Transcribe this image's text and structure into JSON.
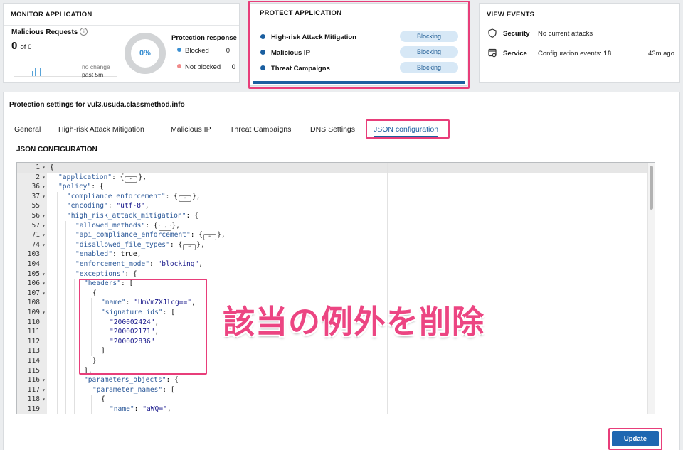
{
  "monitor": {
    "title": "MONITOR APPLICATION",
    "malicious_label": "Malicious Requests",
    "info_icon": "ⓘ",
    "value": "0",
    "of_text": "of 0",
    "no_change": "no change",
    "past": "past 5m",
    "percent": "0%",
    "protection_title": "Protection response",
    "blocked_label": "Blocked",
    "blocked_count": "0",
    "not_blocked_label": "Not blocked",
    "not_blocked_count": "0",
    "colors": {
      "blocked": "#3b8fd1",
      "not_blocked": "#f08a8a"
    }
  },
  "protect": {
    "title": "PROTECT APPLICATION",
    "rows": [
      {
        "label": "High-risk Attack Mitigation",
        "status": "Blocking"
      },
      {
        "label": "Malicious IP",
        "status": "Blocking"
      },
      {
        "label": "Threat Campaigns",
        "status": "Blocking"
      }
    ]
  },
  "events": {
    "title": "VIEW EVENTS",
    "security_label": "Security",
    "security_value": "No current attacks",
    "service_label": "Service",
    "service_value": "Configuration events:",
    "service_count": "18",
    "service_time": "43m ago",
    "icons": {
      "security": "shield-icon",
      "service": "config-icon"
    }
  },
  "main": {
    "title": "Protection settings for vul3.usuda.classmethod.info",
    "tabs": [
      "General",
      "High-risk Attack Mitigation",
      "Malicious IP",
      "Threat Campaigns",
      "DNS Settings",
      "JSON configuration"
    ],
    "active_tab": "JSON configuration",
    "section_title": "JSON CONFIGURATION",
    "update_label": "Update"
  },
  "code_lines": [
    {
      "n": "1",
      "fold": true,
      "indent": 0,
      "text": "{"
    },
    {
      "n": "2",
      "fold": true,
      "indent": 1,
      "key": "\"application\"",
      "rest": ": {",
      "collapsed": true,
      "tail": "},"
    },
    {
      "n": "36",
      "fold": true,
      "indent": 1,
      "key": "\"policy\"",
      "rest": ": {"
    },
    {
      "n": "37",
      "fold": true,
      "indent": 2,
      "key": "\"compliance_enforcement\"",
      "rest": ": {",
      "collapsed": true,
      "tail": "},"
    },
    {
      "n": "55",
      "fold": false,
      "indent": 2,
      "key": "\"encoding\"",
      "rest": ": ",
      "str": "\"utf-8\"",
      "tail": ","
    },
    {
      "n": "56",
      "fold": true,
      "indent": 2,
      "key": "\"high_risk_attack_mitigation\"",
      "rest": ": {"
    },
    {
      "n": "57",
      "fold": true,
      "indent": 3,
      "key": "\"allowed_methods\"",
      "rest": ": {",
      "collapsed": true,
      "tail": "},"
    },
    {
      "n": "71",
      "fold": true,
      "indent": 3,
      "key": "\"api_compliance_enforcement\"",
      "rest": ": {",
      "collapsed": true,
      "tail": "},"
    },
    {
      "n": "74",
      "fold": true,
      "indent": 3,
      "key": "\"disallowed_file_types\"",
      "rest": ": {",
      "collapsed": true,
      "tail": "},"
    },
    {
      "n": "103",
      "fold": false,
      "indent": 3,
      "key": "\"enabled\"",
      "rest": ": true,"
    },
    {
      "n": "104",
      "fold": false,
      "indent": 3,
      "key": "\"enforcement_mode\"",
      "rest": ": ",
      "str": "\"blocking\"",
      "tail": ","
    },
    {
      "n": "105",
      "fold": true,
      "indent": 3,
      "key": "\"exceptions\"",
      "rest": ": {"
    },
    {
      "n": "106",
      "fold": true,
      "indent": 4,
      "key": "\"headers\"",
      "rest": ": ["
    },
    {
      "n": "107",
      "fold": true,
      "indent": 5,
      "text": "{"
    },
    {
      "n": "108",
      "fold": false,
      "indent": 6,
      "key": "\"name\"",
      "rest": ": ",
      "str": "\"UmVmZXJlcg==\"",
      "tail": ","
    },
    {
      "n": "109",
      "fold": true,
      "indent": 6,
      "key": "\"signature_ids\"",
      "rest": ": ["
    },
    {
      "n": "110",
      "fold": false,
      "indent": 7,
      "str": "\"200002424\"",
      "tail": ","
    },
    {
      "n": "111",
      "fold": false,
      "indent": 7,
      "str": "\"200002171\"",
      "tail": ","
    },
    {
      "n": "112",
      "fold": false,
      "indent": 7,
      "str": "\"200002836\""
    },
    {
      "n": "113",
      "fold": false,
      "indent": 6,
      "text": "]"
    },
    {
      "n": "114",
      "fold": false,
      "indent": 5,
      "text": "}"
    },
    {
      "n": "115",
      "fold": false,
      "indent": 4,
      "text": "],"
    },
    {
      "n": "116",
      "fold": true,
      "indent": 4,
      "key": "\"parameters_objects\"",
      "rest": ": {"
    },
    {
      "n": "117",
      "fold": true,
      "indent": 5,
      "key": "\"parameter_names\"",
      "rest": ": ["
    },
    {
      "n": "118",
      "fold": true,
      "indent": 6,
      "text": "{"
    },
    {
      "n": "119",
      "fold": false,
      "indent": 7,
      "key": "\"name\"",
      "rest": ": ",
      "str": "\"aWQ=\"",
      "tail": ","
    }
  ],
  "annotation": "該当の例外を削除"
}
